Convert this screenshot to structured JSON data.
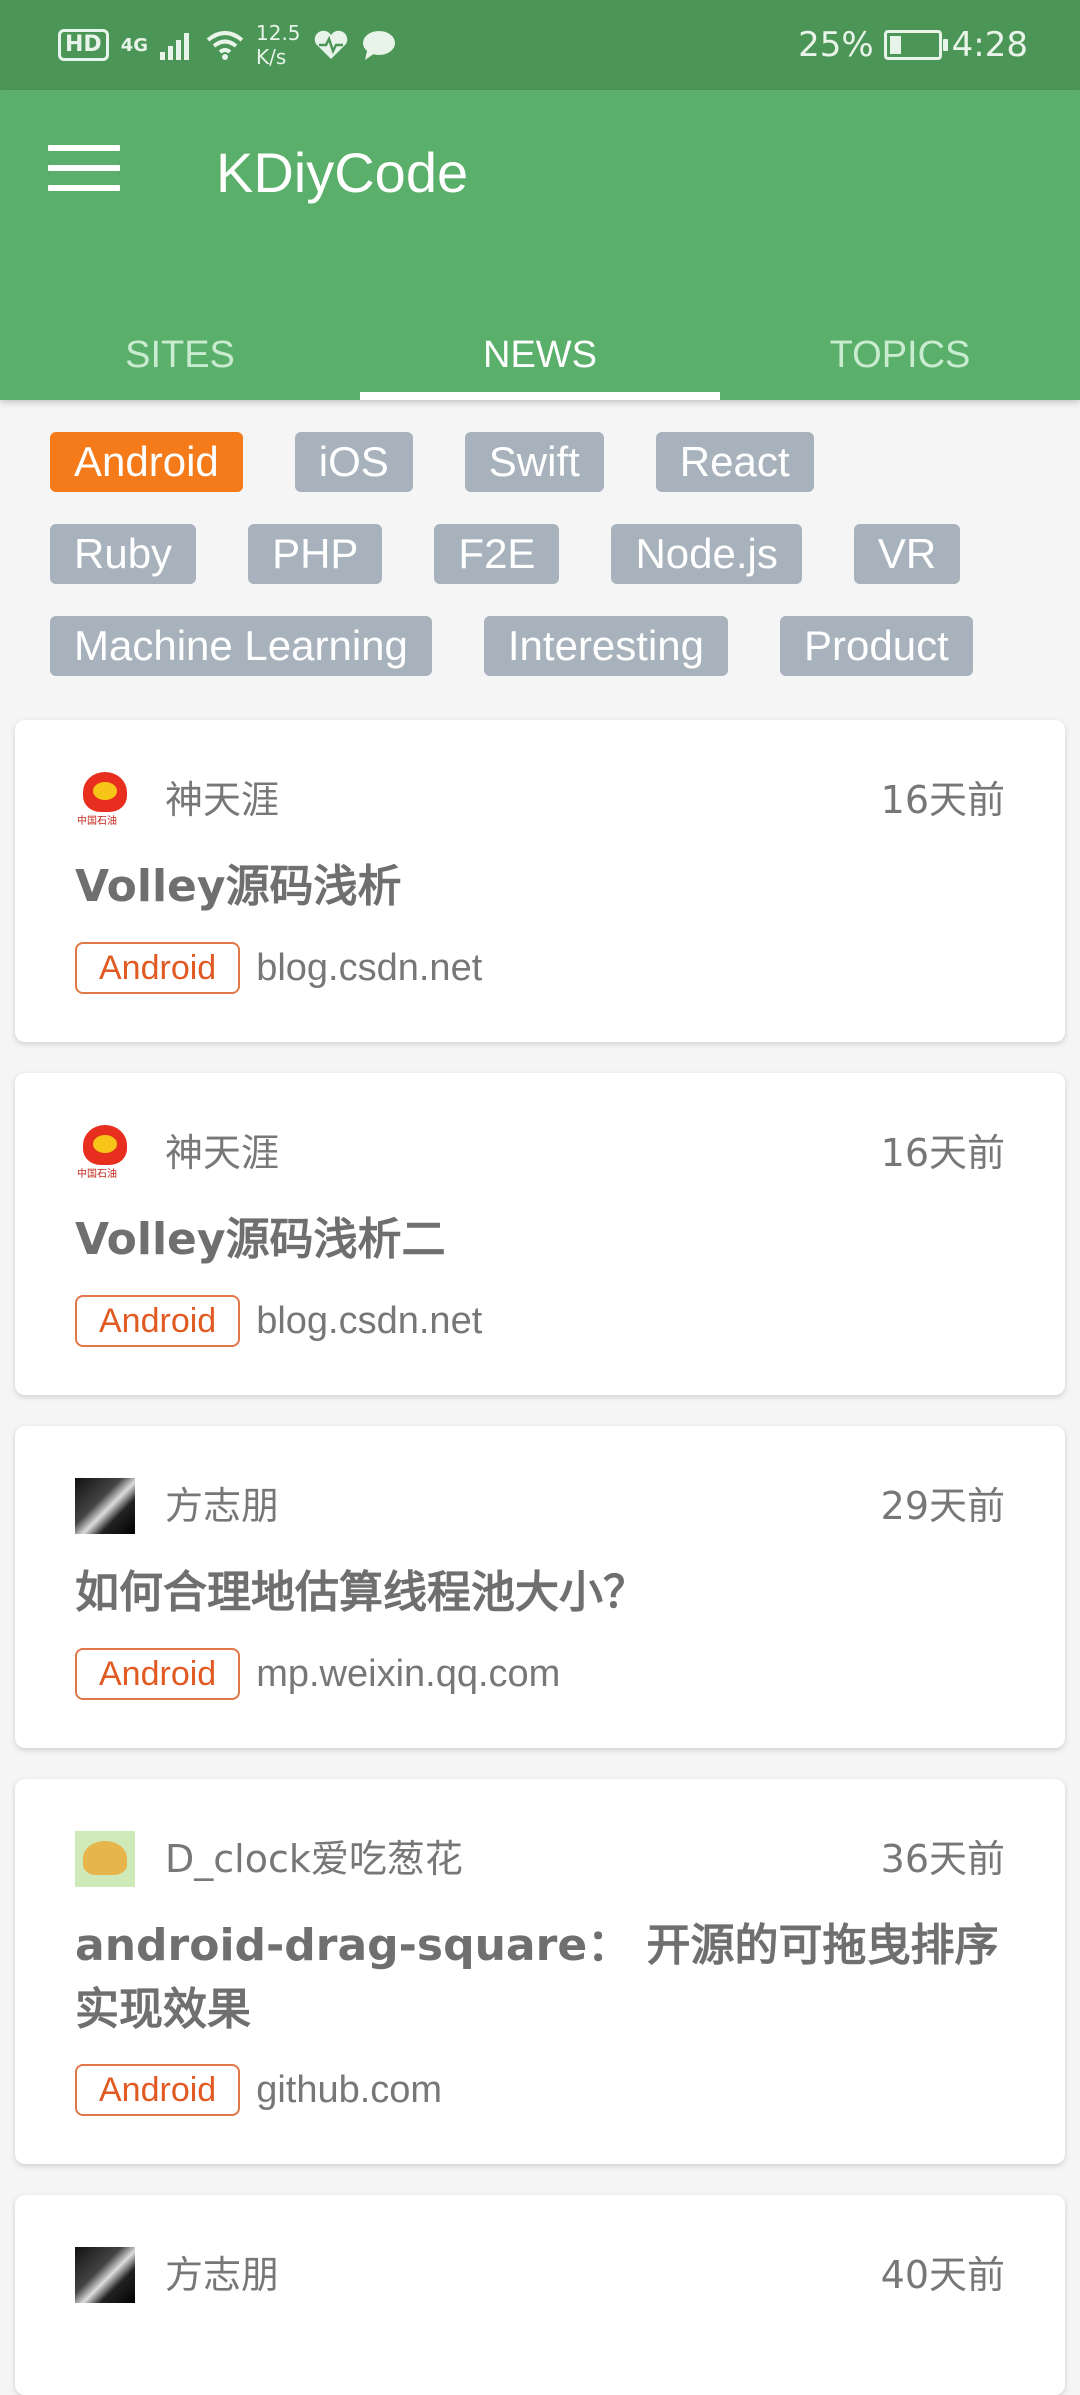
{
  "status_bar": {
    "hd": "HD",
    "network": "4G",
    "speed_value": "12.5",
    "speed_unit": "K/s",
    "battery": "25%",
    "battery_level": 0.25,
    "time": "4:28"
  },
  "app_bar": {
    "title": "KDiyCode",
    "menu_icon": "hamburger-menu-icon"
  },
  "tabs": [
    {
      "label": "SITES",
      "active": false
    },
    {
      "label": "NEWS",
      "active": true
    },
    {
      "label": "TOPICS",
      "active": false
    }
  ],
  "tags": [
    [
      "Android",
      "iOS",
      "Swift",
      "React"
    ],
    [
      "Ruby",
      "PHP",
      "F2E",
      "Node.js",
      "VR"
    ],
    [
      "Machine Learning",
      "Interesting",
      "Product"
    ]
  ],
  "selected_tag": "Android",
  "news": [
    {
      "author": "神天涯",
      "time": "16天前",
      "title": "Volley源码浅析",
      "node": "Android",
      "host": "blog.csdn.net",
      "avatar": "cnpc-logo",
      "avatar_text": "中国石油"
    },
    {
      "author": "神天涯",
      "time": "16天前",
      "title": "Volley源码浅析二",
      "node": "Android",
      "host": "blog.csdn.net",
      "avatar": "cnpc-logo",
      "avatar_text": "中国石油"
    },
    {
      "author": "方志朋",
      "time": "29天前",
      "title": "如何合理地估算线程池大小？",
      "node": "Android",
      "host": "mp.weixin.qq.com",
      "avatar": "photo"
    },
    {
      "author": "D_clock爱吃葱花",
      "time": "36天前",
      "title": "android-drag-square： 开源的可拖曳排序实现效果",
      "node": "Android",
      "host": "github.com",
      "avatar": "straw-hat"
    },
    {
      "author": "方志朋",
      "time": "40天前",
      "avatar": "photo"
    }
  ],
  "colors": {
    "status_bar": "#4b9656",
    "app_bar": "#5aaf6a",
    "tag_active": "#f57b1a",
    "tag_inactive": "#a8b2bc",
    "node_tag": "#e05a22"
  }
}
